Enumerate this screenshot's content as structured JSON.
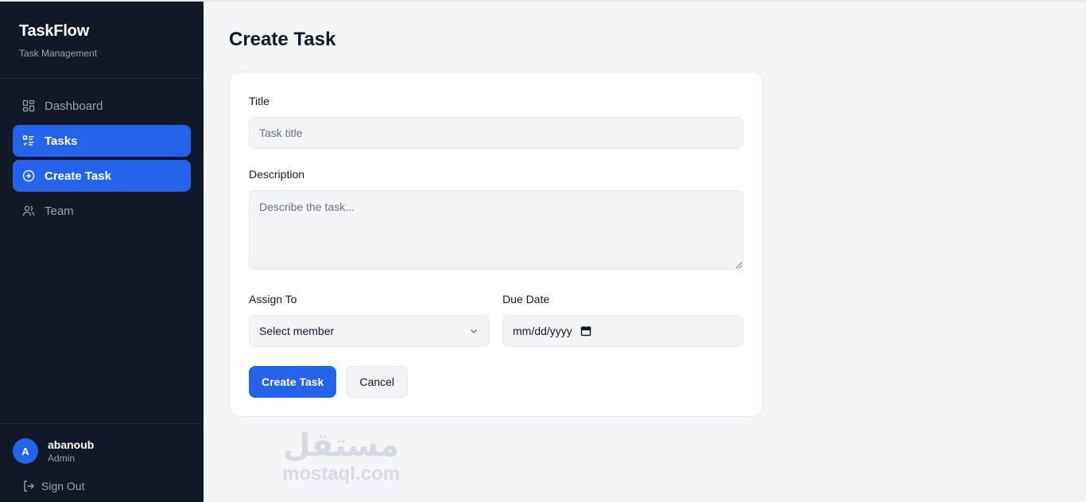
{
  "brand": {
    "title": "TaskFlow",
    "subtitle": "Task Management"
  },
  "nav": {
    "items": [
      {
        "label": "Dashboard",
        "icon": "dashboard-icon",
        "active": false
      },
      {
        "label": "Tasks",
        "icon": "tasks-icon",
        "active": true
      },
      {
        "label": "Create Task",
        "icon": "plus-circle-icon",
        "active": true
      },
      {
        "label": "Team",
        "icon": "team-icon",
        "active": false
      }
    ]
  },
  "user": {
    "initial": "A",
    "name": "abanoub",
    "role": "Admin"
  },
  "signout": {
    "label": "Sign Out"
  },
  "page": {
    "title": "Create Task"
  },
  "form": {
    "title": {
      "label": "Title",
      "placeholder": "Task title"
    },
    "description": {
      "label": "Description",
      "placeholder": "Describe the task..."
    },
    "assign": {
      "label": "Assign To",
      "value": "Select member"
    },
    "due": {
      "label": "Due Date",
      "value": "mm/dd/yyyy"
    },
    "submit_label": "Create Task",
    "cancel_label": "Cancel"
  },
  "watermark": {
    "arabic": "مستقل",
    "latin": "mostaql.com"
  },
  "colors": {
    "accent": "#2563eb",
    "sidebar": "#111827",
    "background": "#f4f5f7"
  }
}
